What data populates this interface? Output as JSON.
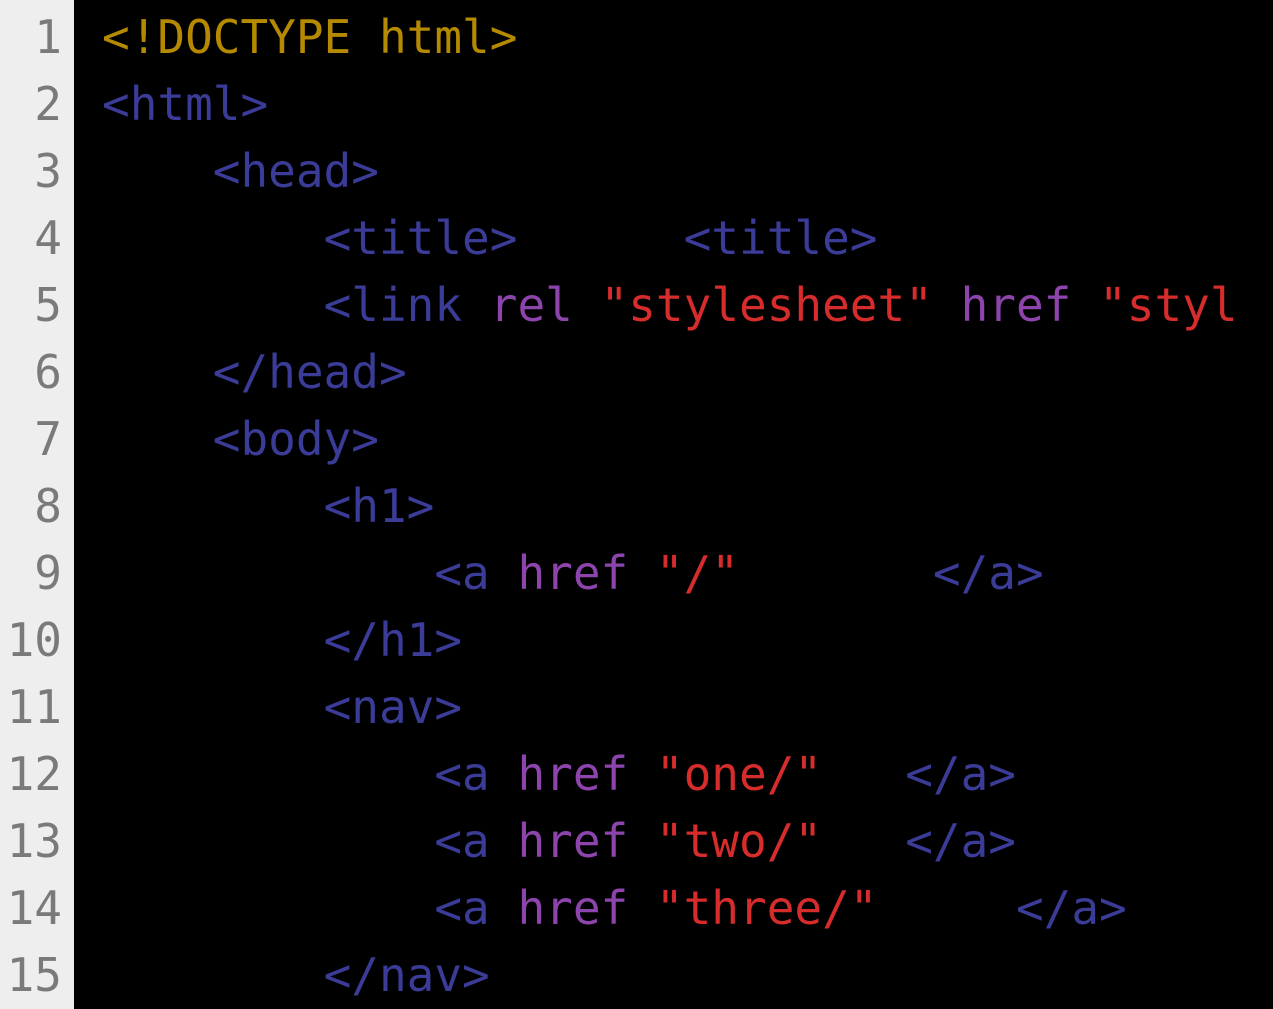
{
  "editor": {
    "line_numbers": [
      "1",
      "2",
      "3",
      "4",
      "5",
      "6",
      "7",
      "8",
      "9",
      "10",
      "11",
      "12",
      "13",
      "14",
      "15"
    ],
    "lines": [
      {
        "indent": 0,
        "tokens": [
          {
            "t": "<!DOCTYPE html>",
            "c": "doctype"
          }
        ]
      },
      {
        "indent": 0,
        "tokens": [
          {
            "t": "<html>",
            "c": "tag"
          }
        ]
      },
      {
        "indent": 1,
        "tokens": [
          {
            "t": "<head>",
            "c": "tag"
          }
        ]
      },
      {
        "indent": 2,
        "tokens": [
          {
            "t": "<title>",
            "c": "tag"
          },
          {
            "t": "      ",
            "c": "plain"
          },
          {
            "t": "<title>",
            "c": "tag"
          }
        ]
      },
      {
        "indent": 2,
        "tokens": [
          {
            "t": "<link",
            "c": "tag"
          },
          {
            "t": " ",
            "c": "plain"
          },
          {
            "t": "rel",
            "c": "attr"
          },
          {
            "t": " ",
            "c": "plain"
          },
          {
            "t": "\"stylesheet\"",
            "c": "str"
          },
          {
            "t": " ",
            "c": "plain"
          },
          {
            "t": "href",
            "c": "attr"
          },
          {
            "t": " ",
            "c": "plain"
          },
          {
            "t": "\"styl",
            "c": "str"
          }
        ]
      },
      {
        "indent": 1,
        "tokens": [
          {
            "t": "</head>",
            "c": "tag"
          }
        ]
      },
      {
        "indent": 1,
        "tokens": [
          {
            "t": "<body>",
            "c": "tag"
          }
        ]
      },
      {
        "indent": 2,
        "tokens": [
          {
            "t": "<h1>",
            "c": "tag"
          }
        ]
      },
      {
        "indent": 3,
        "tokens": [
          {
            "t": "<a",
            "c": "tag"
          },
          {
            "t": " ",
            "c": "plain"
          },
          {
            "t": "href",
            "c": "attr"
          },
          {
            "t": " ",
            "c": "plain"
          },
          {
            "t": "\"/\"",
            "c": "str"
          },
          {
            "t": "       ",
            "c": "plain"
          },
          {
            "t": "</a>",
            "c": "tag"
          }
        ]
      },
      {
        "indent": 2,
        "tokens": [
          {
            "t": "</h1>",
            "c": "tag"
          }
        ]
      },
      {
        "indent": 2,
        "tokens": [
          {
            "t": "<nav>",
            "c": "tag"
          }
        ]
      },
      {
        "indent": 3,
        "tokens": [
          {
            "t": "<a",
            "c": "tag"
          },
          {
            "t": " ",
            "c": "plain"
          },
          {
            "t": "href",
            "c": "attr"
          },
          {
            "t": " ",
            "c": "plain"
          },
          {
            "t": "\"one/\"",
            "c": "str"
          },
          {
            "t": "   ",
            "c": "plain"
          },
          {
            "t": "</a>",
            "c": "tag"
          }
        ]
      },
      {
        "indent": 3,
        "tokens": [
          {
            "t": "<a",
            "c": "tag"
          },
          {
            "t": " ",
            "c": "plain"
          },
          {
            "t": "href",
            "c": "attr"
          },
          {
            "t": " ",
            "c": "plain"
          },
          {
            "t": "\"two/\"",
            "c": "str"
          },
          {
            "t": "   ",
            "c": "plain"
          },
          {
            "t": "</a>",
            "c": "tag"
          }
        ]
      },
      {
        "indent": 3,
        "tokens": [
          {
            "t": "<a",
            "c": "tag"
          },
          {
            "t": " ",
            "c": "plain"
          },
          {
            "t": "href",
            "c": "attr"
          },
          {
            "t": " ",
            "c": "plain"
          },
          {
            "t": "\"three/\"",
            "c": "str"
          },
          {
            "t": "     ",
            "c": "plain"
          },
          {
            "t": "</a>",
            "c": "tag"
          }
        ]
      },
      {
        "indent": 2,
        "tokens": [
          {
            "t": "</nav>",
            "c": "tag"
          }
        ]
      }
    ],
    "indent_unit": "    "
  }
}
